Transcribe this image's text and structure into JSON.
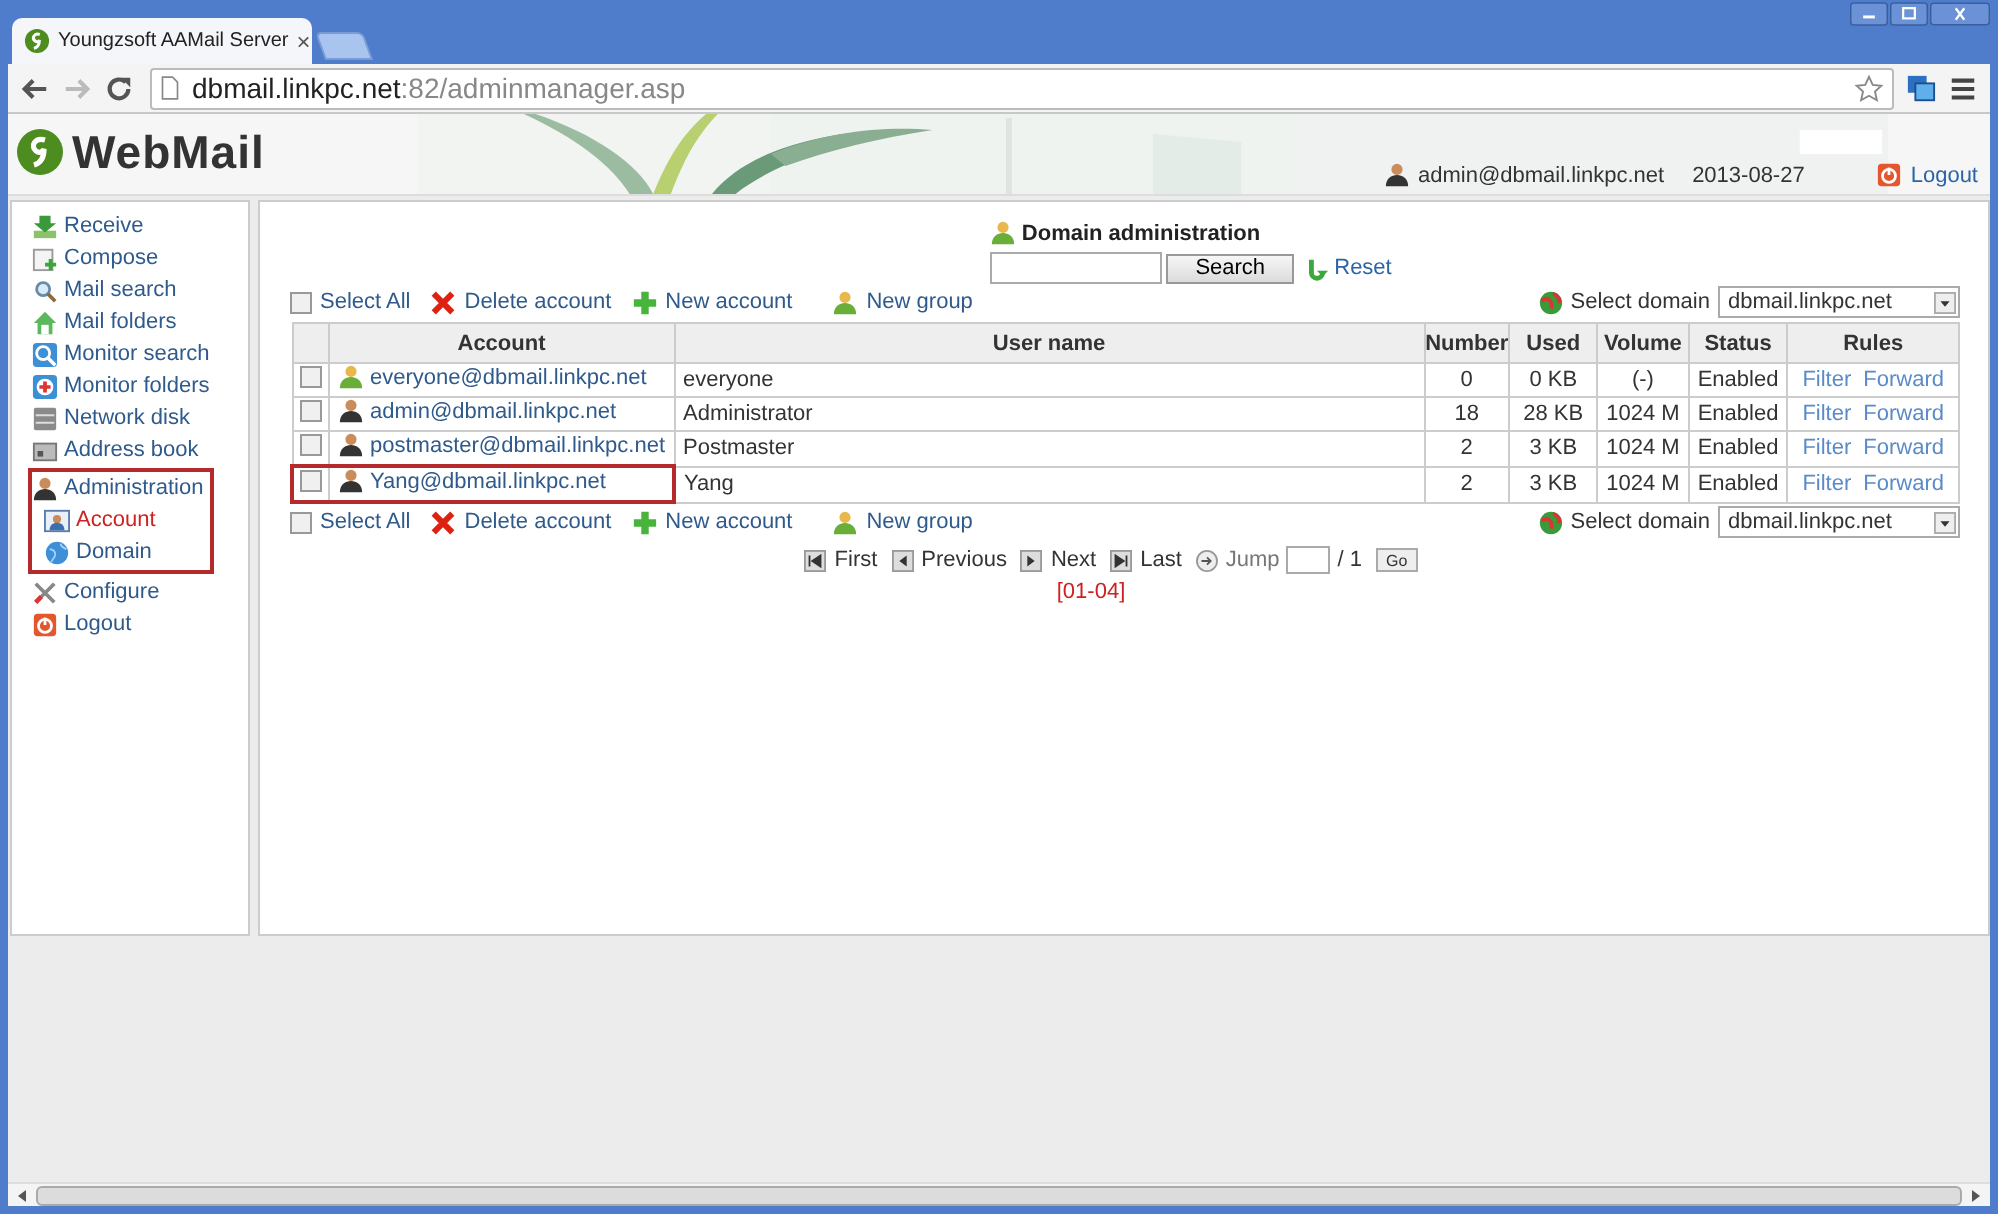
{
  "browser": {
    "tab_title": "Youngzsoft AAMail Server",
    "tab_close": "×",
    "url_host": "dbmail.linkpc.net",
    "url_path": ":82/adminmanager.asp"
  },
  "header": {
    "logo": "WebMail",
    "user": "admin@dbmail.linkpc.net",
    "date": "2013-08-27",
    "logout": "Logout"
  },
  "sidebar": {
    "items": [
      {
        "label": "Receive",
        "selected": false
      },
      {
        "label": "Compose",
        "selected": false
      },
      {
        "label": "Mail search",
        "selected": false
      },
      {
        "label": "Mail folders",
        "selected": false
      },
      {
        "label": "Monitor search",
        "selected": false
      },
      {
        "label": "Monitor folders",
        "selected": false
      },
      {
        "label": "Network disk",
        "selected": false
      },
      {
        "label": "Address book",
        "selected": false
      },
      {
        "label": "Administration",
        "selected": false,
        "highlighted": true,
        "children": [
          {
            "label": "Account",
            "selected": true
          },
          {
            "label": "Domain",
            "selected": false
          }
        ]
      },
      {
        "label": "Configure",
        "selected": false
      },
      {
        "label": "Logout",
        "selected": false
      }
    ]
  },
  "panel": {
    "title": "Domain administration",
    "search_button": "Search",
    "reset": "Reset",
    "toolbars": [
      {
        "select_all": "Select All",
        "checked": false,
        "delete": "Delete account",
        "new_account": "New account",
        "new_group": "New group",
        "domain_label": "Select domain",
        "domain_value": "dbmail.linkpc.net"
      },
      {
        "select_all": "Select All",
        "checked": false,
        "delete": "Delete account",
        "new_account": "New account",
        "new_group": "New group",
        "domain_label": "Select domain",
        "domain_value": "dbmail.linkpc.net"
      }
    ],
    "table": {
      "columns": [
        "Account",
        "User name",
        "Number",
        "Used",
        "Volume",
        "Status",
        "Rules"
      ],
      "rows": [
        {
          "kind": "group",
          "checked": false,
          "highlighted": false,
          "account": "everyone@dbmail.linkpc.net",
          "user_name": "everyone",
          "number": "0",
          "used": "0 KB",
          "volume": "(-)",
          "status": "Enabled",
          "rules": [
            "Filter",
            "Forward"
          ]
        },
        {
          "kind": "user",
          "checked": false,
          "highlighted": false,
          "account": "admin@dbmail.linkpc.net",
          "user_name": "Administrator",
          "number": "18",
          "used": "28 KB",
          "volume": "1024 M",
          "status": "Enabled",
          "rules": [
            "Filter",
            "Forward"
          ]
        },
        {
          "kind": "user",
          "checked": false,
          "highlighted": false,
          "account": "postmaster@dbmail.linkpc.net",
          "user_name": "Postmaster",
          "number": "2",
          "used": "3 KB",
          "volume": "1024 M",
          "status": "Enabled",
          "rules": [
            "Filter",
            "Forward"
          ]
        },
        {
          "kind": "user",
          "checked": false,
          "highlighted": true,
          "account": "Yang@dbmail.linkpc.net",
          "user_name": "Yang",
          "number": "2",
          "used": "3 KB",
          "volume": "1024 M",
          "status": "Enabled",
          "rules": [
            "Filter",
            "Forward"
          ]
        }
      ]
    },
    "pagination": {
      "first": "First",
      "previous": "Previous",
      "next": "Next",
      "last": "Last",
      "jump": "Jump",
      "total": "/ 1",
      "go": "Go",
      "range": "[01-04]"
    }
  }
}
